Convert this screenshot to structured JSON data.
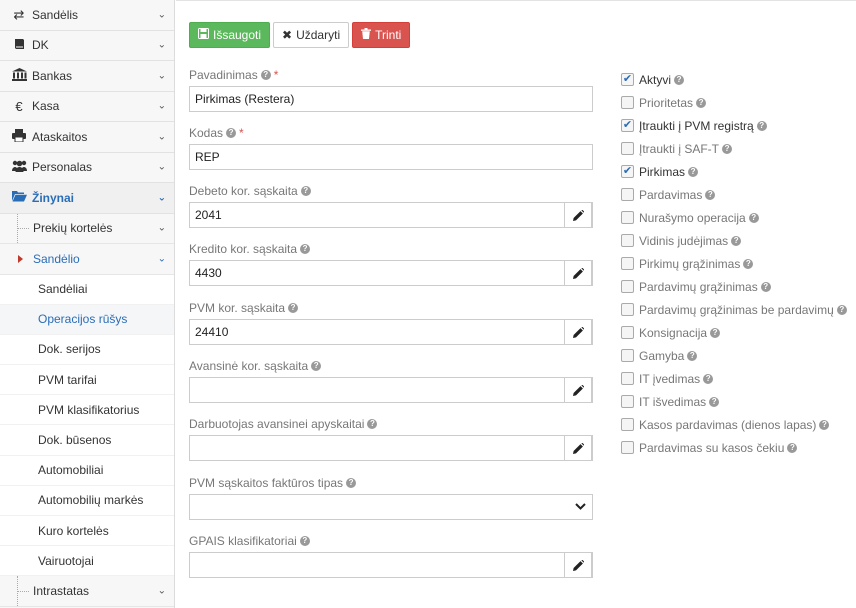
{
  "sidebar": {
    "items_top": [
      {
        "label": "Sandėlis",
        "icon": "exchange-icon"
      },
      {
        "label": "DK",
        "icon": "book-icon"
      },
      {
        "label": "Bankas",
        "icon": "bank-icon"
      },
      {
        "label": "Kasa",
        "icon": "euro-icon"
      },
      {
        "label": "Ataskaitos",
        "icon": "print-icon"
      },
      {
        "label": "Personalas",
        "icon": "users-icon"
      }
    ],
    "active": {
      "label": "Žinynai",
      "icon": "folder-open-icon"
    },
    "sub_prekiu": "Prekių kortelės",
    "sub_sandelio": "Sandėlio",
    "leaves": [
      "Sandėliai",
      "Operacijos rūšys",
      "Dok. serijos",
      "PVM tarifai",
      "PVM klasifikatorius",
      "Dok. būsenos",
      "Automobiliai",
      "Automobilių markės",
      "Kuro kortelės",
      "Vairuotojai"
    ],
    "sub_intrastatas": "Intrastatas"
  },
  "toolbar": {
    "save": "Išsaugoti",
    "close": "Uždaryti",
    "delete": "Trinti"
  },
  "form": {
    "pavadinimas": {
      "label": "Pavadinimas",
      "value": "Pirkimas (Restera)"
    },
    "kodas": {
      "label": "Kodas",
      "value": "REP"
    },
    "debeto": {
      "label": "Debeto kor. sąskaita",
      "value": "2041"
    },
    "kredito": {
      "label": "Kredito kor. sąskaita",
      "value": "4430"
    },
    "pvm": {
      "label": "PVM kor. sąskaita",
      "value": "24410"
    },
    "avansine": {
      "label": "Avansinė kor. sąskaita",
      "value": ""
    },
    "darbuotojas": {
      "label": "Darbuotojas avansinei apyskaitai",
      "value": ""
    },
    "faktura": {
      "label": "PVM sąskaitos faktūros tipas",
      "value": ""
    },
    "gpais": {
      "label": "GPAIS klasifikatoriai",
      "value": ""
    }
  },
  "checkboxes": [
    {
      "label": "Aktyvi",
      "checked": true
    },
    {
      "label": "Prioritetas",
      "checked": false
    },
    {
      "label": "Įtraukti į PVM registrą",
      "checked": true
    },
    {
      "label": "Įtraukti į SAF-T",
      "checked": false
    },
    {
      "label": "Pirkimas",
      "checked": true
    },
    {
      "label": "Pardavimas",
      "checked": false
    },
    {
      "label": "Nurašymo operacija",
      "checked": false
    },
    {
      "label": "Vidinis judėjimas",
      "checked": false
    },
    {
      "label": "Pirkimų grąžinimas",
      "checked": false
    },
    {
      "label": "Pardavimų grąžinimas",
      "checked": false
    },
    {
      "label": "Pardavimų grąžinimas be pardavimų",
      "checked": false
    },
    {
      "label": "Konsignacija",
      "checked": false
    },
    {
      "label": "Gamyba",
      "checked": false
    },
    {
      "label": "IT įvedimas",
      "checked": false
    },
    {
      "label": "IT išvedimas",
      "checked": false
    },
    {
      "label": "Kasos pardavimas (dienos lapas)",
      "checked": false
    },
    {
      "label": "Pardavimas su kasos čekiu",
      "checked": false
    }
  ],
  "colors": {
    "accent": "#2a6db7",
    "save": "#5cb85c",
    "delete": "#d9534f"
  }
}
